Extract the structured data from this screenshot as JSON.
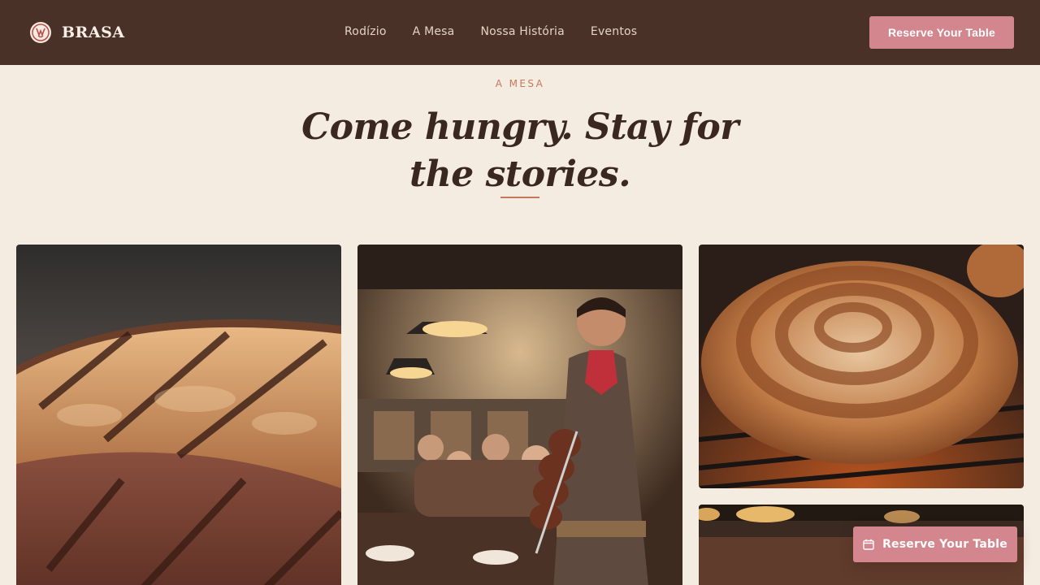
{
  "header": {
    "brand_name": "BRASA",
    "nav": [
      "Rodízio",
      "A Mesa",
      "Nossa História",
      "Eventos"
    ],
    "cta_label": "Reserve Your Table"
  },
  "hero": {
    "eyebrow": "A MESA",
    "headline": "Come hungry. Stay for the stories."
  },
  "gallery": {
    "tiles": [
      {
        "icon": "grilled-steak-photo"
      },
      {
        "icon": "gaucho-carving-meat-photo"
      },
      {
        "icon": "grilled-sausage-photo"
      },
      {
        "icon": "restaurant-interior-photo"
      }
    ]
  },
  "floating_cta": {
    "label": "Reserve Your Table",
    "icon": "calendar-icon"
  },
  "colors": {
    "header_bg": "#4a3128",
    "page_bg": "#f4ebe1",
    "accent": "#d3868d",
    "eyebrow": "#c47a5a"
  }
}
